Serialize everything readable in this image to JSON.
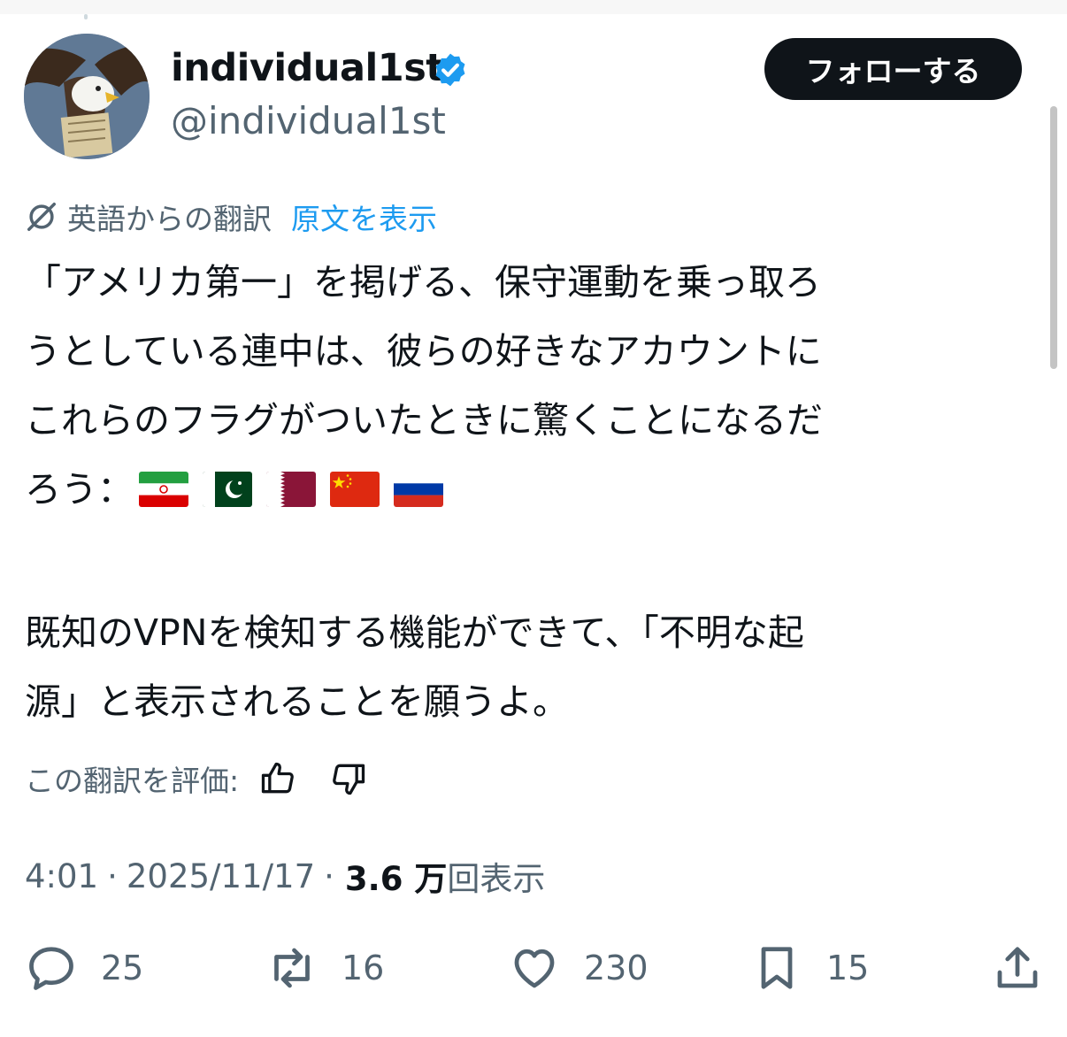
{
  "user": {
    "display_name": "individual1st",
    "handle": "@individual1st",
    "verified_icon": "verified-badge-icon"
  },
  "follow_button": {
    "label": "フォローする"
  },
  "translation": {
    "label": "英語からの翻訳",
    "show_original": "原文を表示"
  },
  "tweet": {
    "line1": "「アメリカ第一」を掲げる、保守運動を乗っ取ろ",
    "line2": "うとしている連中は、彼らの好きなアカウントに",
    "line3": "これらのフラグがついたときに驚くことになるだ",
    "line4": "ろう：",
    "flags": [
      "flag-iran",
      "flag-pakistan",
      "flag-qatar",
      "flag-china",
      "flag-russia"
    ],
    "line5": "既知のVPNを検知する機能ができて、「不明な起",
    "line6": "源」と表示されることを願うよ。"
  },
  "rate": {
    "label": "この翻訳を評価:"
  },
  "meta": {
    "time": "4:01",
    "separator": "·",
    "date": "2025/11/17",
    "views_number": "3.6 万",
    "views_suffix": "回表示"
  },
  "actions": {
    "replies": "25",
    "reposts": "16",
    "likes": "230",
    "bookmarks": "15"
  },
  "colors": {
    "link": "#1d9bf0",
    "muted": "#536471",
    "text": "#0f1419"
  }
}
